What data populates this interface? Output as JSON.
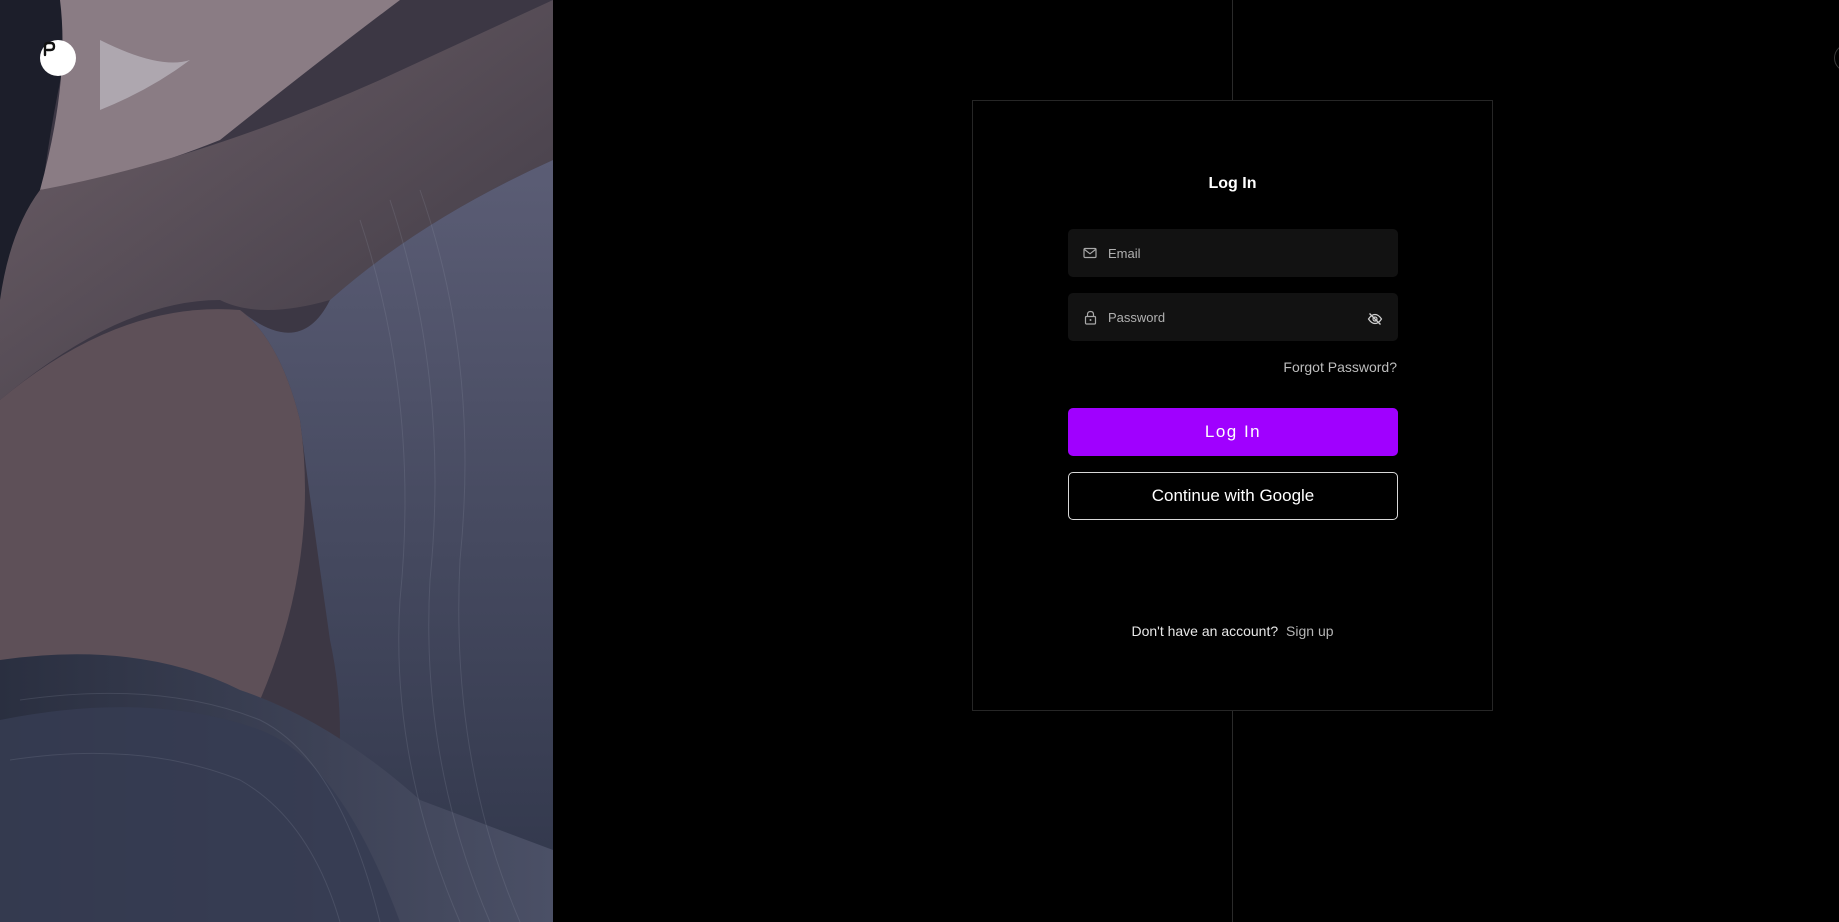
{
  "branding": {
    "logo_icon": "p-logo-icon"
  },
  "login_card": {
    "title": "Log In",
    "email": {
      "placeholder": "Email",
      "value": "",
      "icon": "mail-icon"
    },
    "password": {
      "placeholder": "Password",
      "value": "",
      "icon": "lock-icon",
      "toggle_icon": "eye-off-icon"
    },
    "forgot_password": "Forgot Password?",
    "login_button": "Log In",
    "google_button": "Continue with Google",
    "signup_prompt": "Don't have an account?",
    "signup_link": "Sign up"
  },
  "colors": {
    "accent": "#a000ff",
    "background": "#000000",
    "field_bg": "#121212"
  }
}
